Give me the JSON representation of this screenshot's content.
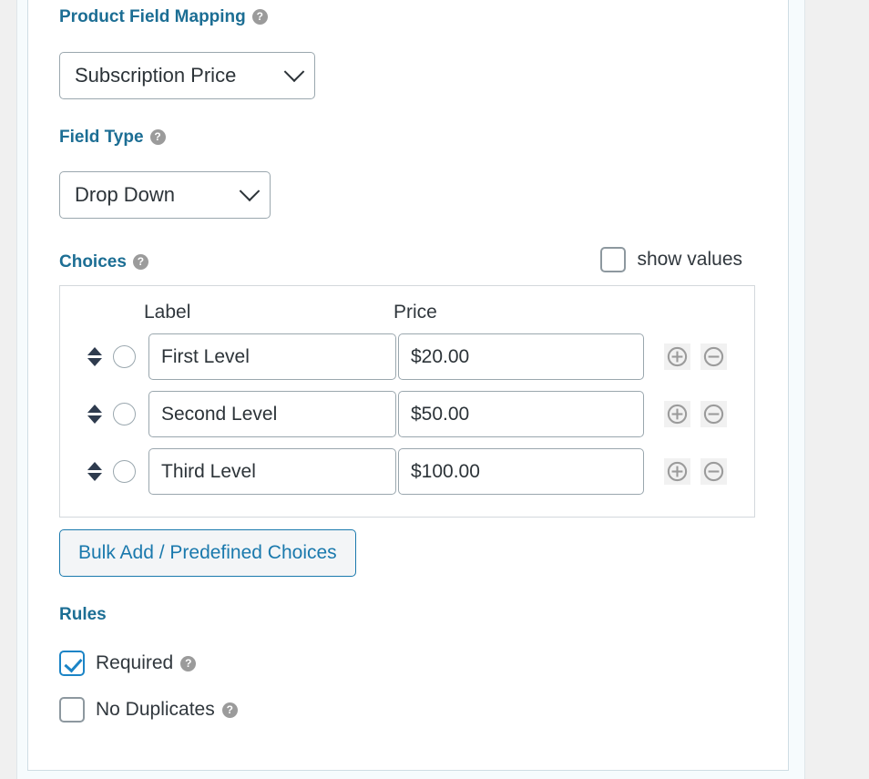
{
  "sections": {
    "product_field_mapping": {
      "label": "Product Field Mapping",
      "help": "?",
      "select_value": "Subscription Price"
    },
    "field_type": {
      "label": "Field Type",
      "help": "?",
      "select_value": "Drop Down"
    },
    "choices": {
      "label": "Choices",
      "help": "?",
      "show_values_label": "show values",
      "show_values_checked": false,
      "columns": {
        "label": "Label",
        "price": "Price"
      },
      "rows": [
        {
          "label": "First Level",
          "price": "$20.00",
          "selected": false
        },
        {
          "label": "Second Level",
          "price": "$50.00",
          "selected": false
        },
        {
          "label": "Third Level",
          "price": "$100.00",
          "selected": false
        }
      ],
      "add_icon": "plus-circle-icon",
      "remove_icon": "minus-circle-icon",
      "drag_icon": "drag-updown-icon",
      "bulk_button": "Bulk Add / Predefined Choices"
    },
    "rules": {
      "label": "Rules",
      "items": [
        {
          "label": "Required",
          "help": "?",
          "checked": true
        },
        {
          "label": "No Duplicates",
          "help": "?",
          "checked": false
        }
      ]
    }
  },
  "colors": {
    "heading_blue": "#1c6e94",
    "accent_blue": "#1b84c6",
    "button_blue": "#1a79ad",
    "text_dark": "#30373d",
    "border_gray": "#9aa7ae",
    "help_gray": "#9b9b9b",
    "page_bg": "#f0f0f0",
    "panel_bg": "#f6fbfd"
  }
}
